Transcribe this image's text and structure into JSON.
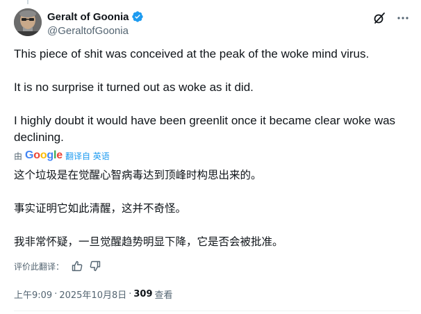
{
  "author": {
    "display_name": "Geralt of Goonia",
    "handle": "@GeraltofGoonia",
    "avatar_icon": "avatar-image",
    "verified_icon": "verified-badge-icon"
  },
  "colors": {
    "accent": "#1d9bf0",
    "text": "#0f1419",
    "secondary": "#536471"
  },
  "tweet": {
    "paragraphs": [
      "This piece of shit was conceived at the peak of the woke mind virus.",
      "It is no surprise it turned out as woke as it did.",
      "I highly doubt it would have been greenlit once it became clear woke was declining."
    ]
  },
  "translation": {
    "by_label": "由",
    "provider": "Google",
    "link_label": "翻译自 英语",
    "paragraphs": [
      "这个垃圾是在觉醒心智病毒达到顶峰时构思出来的。",
      "事实证明它如此清醒，这并不奇怪。",
      "我非常怀疑，一旦觉醒趋势明显下降，它是否会被批准。"
    ],
    "rate_label": "评价此翻译："
  },
  "meta": {
    "time": "上午9:09",
    "sep1": "·",
    "date": "2025年10月8日",
    "sep2": "·",
    "views": "309",
    "views_label": "查看"
  }
}
